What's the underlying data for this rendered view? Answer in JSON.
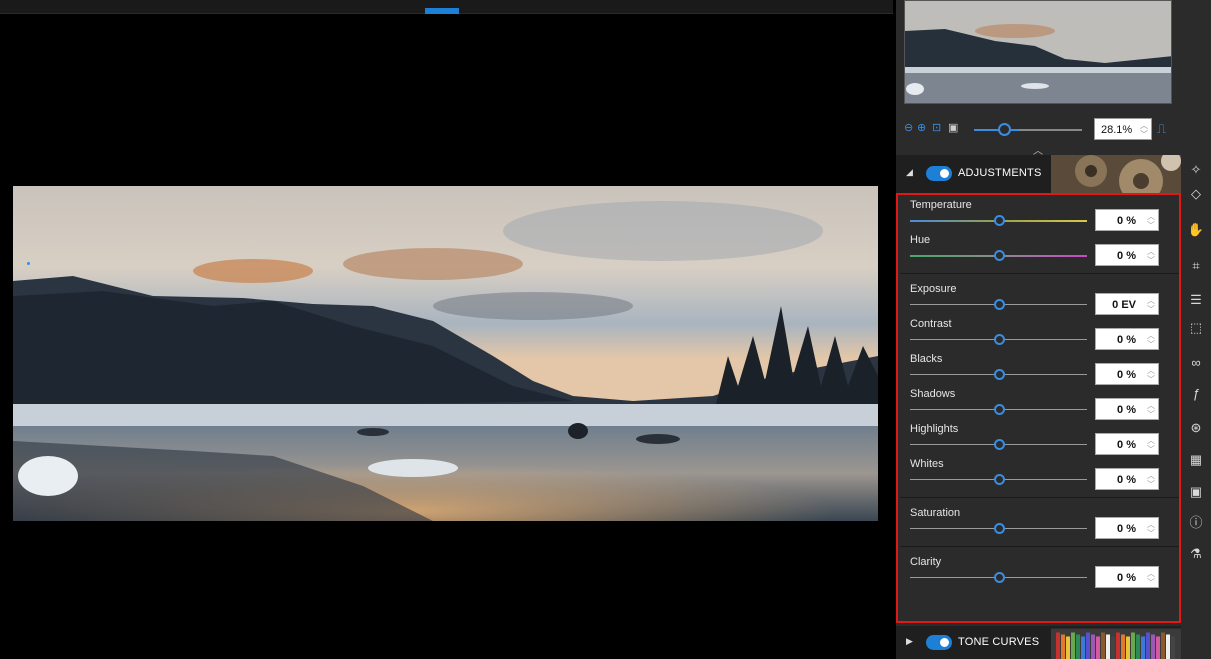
{
  "viewer": {
    "photo_description_icon": "landscape-photo"
  },
  "navigator": {
    "zoom_value": "28.1%",
    "zoom_level_fraction": 0.28,
    "icons": [
      "zoom-out-icon",
      "zoom-in-icon",
      "fit-icon",
      "fill-icon",
      "histogram-icon"
    ]
  },
  "adjustments": {
    "title": "ADJUSTMENTS",
    "enabled": true,
    "groups": [
      [
        {
          "label": "Temperature",
          "value": "0 %",
          "position": 0.5
        },
        {
          "label": "Hue",
          "value": "0 %",
          "position": 0.5
        }
      ],
      [
        {
          "label": "Exposure",
          "value": "0 EV",
          "position": 0.5
        },
        {
          "label": "Contrast",
          "value": "0 %",
          "position": 0.5
        },
        {
          "label": "Blacks",
          "value": "0 %",
          "position": 0.5
        },
        {
          "label": "Shadows",
          "value": "0 %",
          "position": 0.5
        },
        {
          "label": "Highlights",
          "value": "0 %",
          "position": 0.5
        },
        {
          "label": "Whites",
          "value": "0 %",
          "position": 0.5
        }
      ],
      [
        {
          "label": "Saturation",
          "value": "0 %",
          "position": 0.5
        }
      ],
      [
        {
          "label": "Clarity",
          "value": "0 %",
          "position": 0.5
        }
      ]
    ]
  },
  "tone_curves": {
    "title": "TONE CURVES",
    "enabled": true
  },
  "rail_icons": [
    "auto-enhance-icon",
    "eraser-icon",
    "retouch-icon",
    "crop-icon",
    "sliders-icon",
    "selection-icon",
    "red-eye-icon",
    "effects-icon",
    "color-icon",
    "pattern-icon",
    "frame-icon",
    "info-icon",
    "lab-icon"
  ],
  "colors": {
    "accent": "#1e7fd6",
    "highlight_border": "#e01818",
    "panel": "#2b2b2b"
  }
}
